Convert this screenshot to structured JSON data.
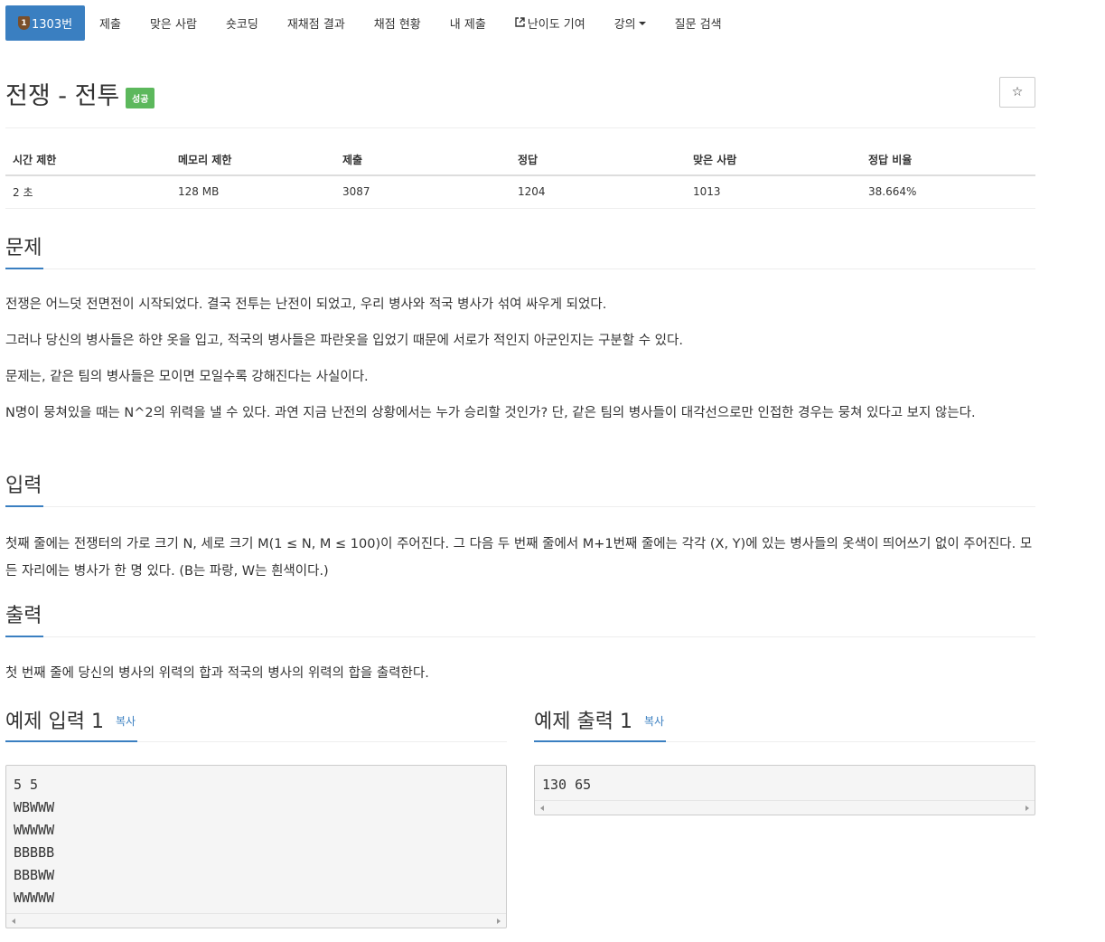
{
  "tabs": [
    {
      "label": "1303번",
      "tier": "1",
      "active": true
    },
    {
      "label": "제출"
    },
    {
      "label": "맞은 사람"
    },
    {
      "label": "숏코딩"
    },
    {
      "label": "재채점 결과"
    },
    {
      "label": "채점 현황"
    },
    {
      "label": "내 제출"
    },
    {
      "label": "난이도 기여"
    },
    {
      "label": "강의"
    },
    {
      "label": "질문 검색"
    }
  ],
  "problem": {
    "title": "전쟁 - 전투",
    "status_badge": "성공",
    "star_icon": "☆"
  },
  "info": {
    "headers": [
      "시간 제한",
      "메모리 제한",
      "제출",
      "정답",
      "맞은 사람",
      "정답 비율"
    ],
    "values": [
      "2 초",
      "128 MB",
      "3087",
      "1204",
      "1013",
      "38.664%"
    ]
  },
  "sections": {
    "description": {
      "heading": "문제",
      "paragraphs": [
        "전쟁은 어느덧 전면전이 시작되었다. 결국 전투는 난전이 되었고, 우리 병사와 적국 병사가 섞여 싸우게 되었다.",
        "그러나 당신의 병사들은 하얀 옷을 입고, 적국의 병사들은 파란옷을 입었기 때문에 서로가 적인지 아군인지는 구분할 수 있다.",
        "문제는, 같은 팀의 병사들은 모이면 모일수록 강해진다는 사실이다.",
        "N명이 뭉쳐있을 때는 N^2의 위력을 낼 수 있다. 과연 지금 난전의 상황에서는 누가 승리할 것인가? 단, 같은 팀의 병사들이 대각선으로만 인접한 경우는 뭉쳐 있다고 보지 않는다."
      ]
    },
    "input": {
      "heading": "입력",
      "paragraphs": [
        "첫째 줄에는 전쟁터의 가로 크기 N, 세로 크기 M(1 ≤ N, M ≤ 100)이 주어진다. 그 다음 두 번째 줄에서 M+1번째 줄에는 각각 (X, Y)에 있는 병사들의 옷색이 띄어쓰기 없이 주어진다. 모든 자리에는 병사가 한 명 있다. (B는 파랑, W는 흰색이다.)"
      ]
    },
    "output": {
      "heading": "출력",
      "paragraphs": [
        "첫 번째 줄에 당신의 병사의 위력의 합과 적국의 병사의 위력의 합을 출력한다."
      ]
    }
  },
  "examples": {
    "input": {
      "title": "예제 입력 1",
      "copy_label": "복사",
      "lines": [
        "5 5",
        "WBWWW",
        "WWWWW",
        "BBBBB",
        "BBBWW",
        "WWWWW"
      ]
    },
    "output": {
      "title": "예제 출력 1",
      "copy_label": "복사",
      "lines": [
        "130 65"
      ]
    }
  }
}
